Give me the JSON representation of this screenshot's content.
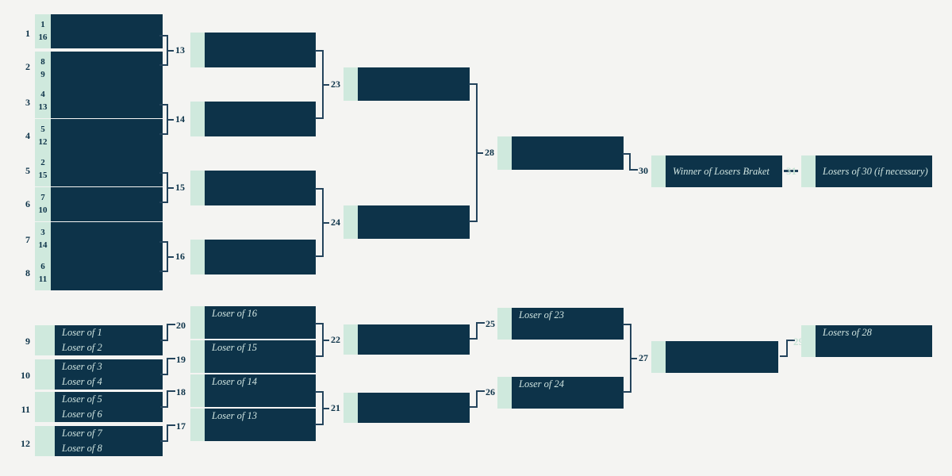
{
  "palette": {
    "background": "#f4f4f2",
    "box_dark": "#0d3349",
    "box_cap": "#cfe9dd",
    "text_light": "#cfe4e0",
    "text_dark": "#0d3349",
    "line": "#24445c",
    "faded_label": "#c6e3d5"
  },
  "winners_bracket": {
    "round1": [
      {
        "game": "1",
        "seed_top": "1",
        "seed_bottom": "16"
      },
      {
        "game": "2",
        "seed_top": "8",
        "seed_bottom": "9"
      },
      {
        "game": "3",
        "seed_top": "4",
        "seed_bottom": "13"
      },
      {
        "game": "4",
        "seed_top": "5",
        "seed_bottom": "12"
      },
      {
        "game": "5",
        "seed_top": "2",
        "seed_bottom": "15"
      },
      {
        "game": "6",
        "seed_top": "7",
        "seed_bottom": "10"
      },
      {
        "game": "7",
        "seed_top": "3",
        "seed_bottom": "14"
      },
      {
        "game": "8",
        "seed_top": "6",
        "seed_bottom": "11"
      }
    ],
    "round2": [
      {
        "game": "13",
        "slot": ""
      },
      {
        "game": "14",
        "slot": ""
      },
      {
        "game": "15",
        "slot": ""
      },
      {
        "game": "16",
        "slot": ""
      }
    ],
    "round3": [
      {
        "game": "23",
        "slot": ""
      },
      {
        "game": "24",
        "slot": ""
      }
    ],
    "round4": [
      {
        "game": "28",
        "slot": ""
      }
    ],
    "final": [
      {
        "game": "30",
        "slot": "Winner of Losers Braket"
      }
    ],
    "if_necessary": [
      {
        "game": "31",
        "slot": "Losers of 30 (if necessary)"
      }
    ]
  },
  "losers_bracket": {
    "round1": [
      {
        "game": "9",
        "slot_top": "Loser of 1",
        "slot_bottom": "Loser of 2"
      },
      {
        "game": "10",
        "slot_top": "Loser of 3",
        "slot_bottom": "Loser of 4"
      },
      {
        "game": "11",
        "slot_top": "Loser of 5",
        "slot_bottom": "Loser of 6"
      },
      {
        "game": "12",
        "slot_top": "Loser of 7",
        "slot_bottom": "Loser of 8"
      }
    ],
    "round2": [
      {
        "game": "20",
        "slot": "Loser of 16"
      },
      {
        "game": "19",
        "slot": "Loser of 15"
      },
      {
        "game": "18",
        "slot": "Loser of 14"
      },
      {
        "game": "17",
        "slot": "Loser of 13"
      }
    ],
    "round3": [
      {
        "game": "22",
        "slot": ""
      },
      {
        "game": "21",
        "slot": ""
      }
    ],
    "round4": [
      {
        "game": "25",
        "slot": "Loser of 23"
      },
      {
        "game": "26",
        "slot": "Loser of 24"
      }
    ],
    "round5": [
      {
        "game": "27",
        "slot": ""
      }
    ],
    "round6": [
      {
        "game": "29",
        "slot": "Losers of 28"
      }
    ]
  },
  "connector_labels": {
    "w_r1_13": "13",
    "w_r1_14": "14",
    "w_r1_15": "15",
    "w_r1_16": "16",
    "w_r2_23": "23",
    "w_r2_24": "24",
    "w_r3_28": "28",
    "w_r4_30": "30",
    "w_final_31": "31",
    "l_r1_20": "20",
    "l_r1_19": "19",
    "l_r1_18": "18",
    "l_r1_17": "17",
    "l_r2_22": "22",
    "l_r2_21": "21",
    "l_r3_25": "25",
    "l_r3_26": "26",
    "l_r4_27": "27",
    "l_r5_29": "29"
  }
}
